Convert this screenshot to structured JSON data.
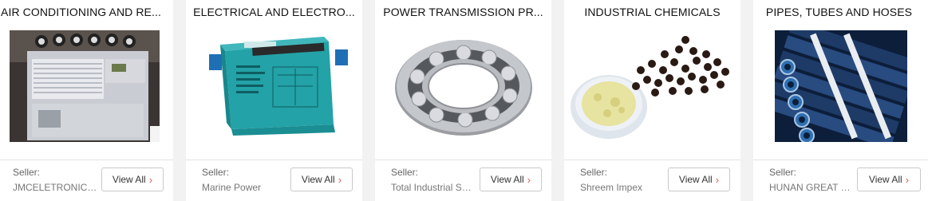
{
  "cards": [
    {
      "title": "AIR CONDITIONING AND RE...",
      "image_desc_icon": "air-conditioner-image",
      "seller_label": "Seller:",
      "seller_name": "JMCELETRONICSL...",
      "button_label": "View All",
      "button_icon": "chevron-right-icon"
    },
    {
      "title": "ELECTRICAL AND ELECTRO...",
      "image_desc_icon": "electrical-module-image",
      "seller_label": "Seller:",
      "seller_name": "Marine Power",
      "button_label": "View All",
      "button_icon": "chevron-right-icon"
    },
    {
      "title": "POWER TRANSMISSION PR...",
      "image_desc_icon": "ball-bearing-image",
      "seller_label": "Seller:",
      "seller_name": "Total Industrial Sol...",
      "button_label": "View All",
      "button_icon": "chevron-right-icon"
    },
    {
      "title": "INDUSTRIAL CHEMICALS",
      "image_desc_icon": "chemical-powder-image",
      "seller_label": "Seller:",
      "seller_name": "Shreem Impex",
      "button_label": "View All",
      "button_icon": "chevron-right-icon"
    },
    {
      "title": "PIPES, TUBES AND HOSES",
      "image_desc_icon": "steel-pipes-image",
      "seller_label": "Seller:",
      "seller_name": "HUNAN GREAT ST...",
      "button_label": "View All",
      "button_icon": "chevron-right-icon"
    }
  ],
  "chevron_glyph": "›",
  "colors": {
    "page_bg": "#f2f2f2",
    "card_bg": "#ffffff",
    "chevron": "#e0584f",
    "module_teal": "#23a2a7",
    "module_blue": "#1f6fb5"
  }
}
